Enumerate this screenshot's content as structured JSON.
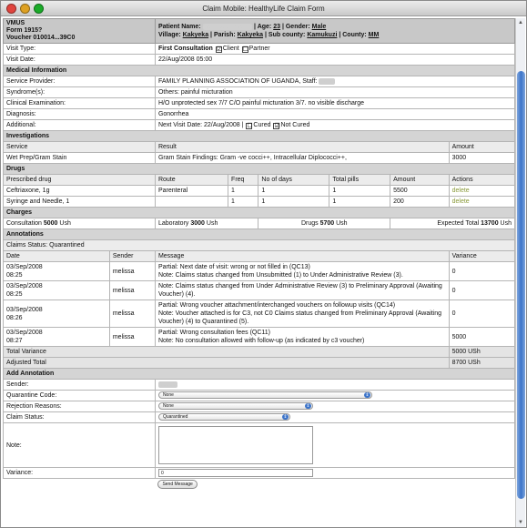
{
  "window": {
    "title": "Claim Mobile: HealthyLife Claim Form"
  },
  "header": {
    "line1": "VMUS",
    "form": "Form 1915?",
    "voucher": "Voucher 010014...39C0",
    "patient_label": "Patient Name:",
    "age_label": "| Age:",
    "age": "23",
    "gender_label": "| Gender:",
    "gender": "Male",
    "village_label": "Village:",
    "village": "Kakyeka",
    "parish_label": "| Parish:",
    "parish": "Kakyeka",
    "subcounty_label": "| Sub county:",
    "subcounty": "Kamukuzi",
    "county_label": "| County:",
    "county": "MM"
  },
  "visit": {
    "type_label": "Visit Type:",
    "type_value": "First Consultation",
    "client_label": "Client",
    "partner_label": "Partner",
    "client_checked": "☑",
    "partner_checked": "☐",
    "date_label": "Visit Date:",
    "date_value": "22/Aug/2008 05:00"
  },
  "medical": {
    "title": "Medical Information",
    "provider_label": "Service Provider:",
    "provider_value": "FAMILY PLANNING ASSOCIATION OF UGANDA, Staff:",
    "syndromes_label": "Syndrome(s):",
    "syndromes_value": "Others: painful micturation",
    "exam_label": "Clinical Examination:",
    "exam_value": "H/O unprotected sex 7/7 C/O painful micturation 3/7. no visible discharge",
    "diagnosis_label": "Diagnosis:",
    "diagnosis_value": "Gonorrhea",
    "additional_label": "Additional:",
    "additional_value": "Next Visit Date: 22/Aug/2008 |",
    "cured_label": "Cured",
    "notcured_label": "Not Cured",
    "cured_checked": "☐",
    "notcured_checked": "☑"
  },
  "investigations": {
    "title": "Investigations",
    "col_service": "Service",
    "col_result": "Result",
    "col_amount": "Amount",
    "rows": [
      {
        "service": "Wet Prep/Gram Stain",
        "result": "Gram Stain Findings: Gram -ve cocci++, Intracellular Diplococci++,",
        "amount": "3000"
      }
    ]
  },
  "drugs": {
    "title": "Drugs",
    "cols": [
      "Prescribed drug",
      "Route",
      "Freq",
      "No of days",
      "Total pills",
      "Amount",
      "Actions"
    ],
    "rows": [
      {
        "drug": "Ceftriaxone, 1g",
        "route": "Parenteral",
        "freq": "1",
        "days": "1",
        "pills": "1",
        "amount": "5500",
        "action": "delete"
      },
      {
        "drug": "Syringe and Needle, 1",
        "route": "",
        "freq": "1",
        "days": "1",
        "pills": "1",
        "amount": "200",
        "action": "delete"
      }
    ]
  },
  "charges": {
    "title": "Charges",
    "consult_label": "Consultation",
    "consult": "5000",
    "lab_label": "Laboratory",
    "lab": "3000",
    "drugs_label": "Drugs",
    "drugs": "5700",
    "expected_label": "Expected Total",
    "expected": "13700",
    "currency": "Ush"
  },
  "annotations": {
    "title": "Annotations",
    "status": "Claims Status: Quarantined",
    "cols": [
      "Date",
      "Sender",
      "Message",
      "Variance"
    ],
    "rows": [
      {
        "date": "03/Sep/2008",
        "time": "08:25",
        "sender": "melissa",
        "message": "Partial: Next date of visit: wrong or not filled in (QC13)\nNote: Claims status changed from Unsubmitted (1) to Under Administrative Review (3).",
        "variance": "0"
      },
      {
        "date": "03/Sep/2008",
        "time": "08:25",
        "sender": "melissa",
        "message": "Note: Claims status changed from Under Administrative Review (3) to Preliminary Approval (Awaiting Voucher) (4).",
        "variance": "0"
      },
      {
        "date": "03/Sep/2008",
        "time": "08:26",
        "sender": "melissa",
        "message": "Partial: Wrong voucher attachment/interchanged vouchers on followup visits (QC14)\nNote: Voucher attached is for C3, not C0 Claims status changed from Preliminary Approval (Awaiting Voucher) (4) to Quarantined (5).",
        "variance": "0"
      },
      {
        "date": "03/Sep/2008",
        "time": "08:27",
        "sender": "melissa",
        "message": "Partial: Wrong consultation fees (QC11)\nNote: No consultation allowed with follow-up (as indicated by c3 voucher)",
        "variance": "5000"
      }
    ],
    "total_variance_label": "Total Variance",
    "total_variance": "5000 USh",
    "adjusted_label": "Adjusted Total",
    "adjusted": "8700 USh"
  },
  "add_annotation": {
    "title": "Add Annotation",
    "sender_label": "Sender:",
    "qcode_label": "Quarantine Code:",
    "qcode_value": "None",
    "rejection_label": "Rejection Reasons:",
    "rejection_value": "None",
    "status_label": "Claim Status:",
    "status_value": "Quarantined",
    "note_label": "Note:",
    "variance_label": "Variance:",
    "variance_value": "0",
    "send_label": "Send Message"
  }
}
